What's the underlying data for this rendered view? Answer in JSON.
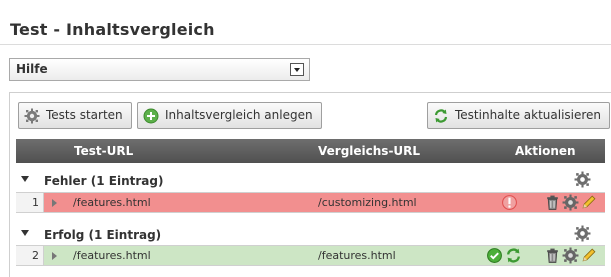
{
  "page": {
    "title": "Test - Inhaltsvergleich"
  },
  "help": {
    "selected": "Hilfe"
  },
  "toolbar": {
    "start_tests": "Tests starten",
    "create_comparison": "Inhaltsvergleich anlegen",
    "update_contents": "Testinhalte aktualisieren"
  },
  "table": {
    "headers": {
      "test_url": "Test-URL",
      "compare_url": "Vergleichs-URL",
      "actions": "Aktionen"
    },
    "groups": [
      {
        "label": "Fehler (1 Eintrag)",
        "status": "error",
        "rows": [
          {
            "index": "1",
            "test_url": "/features.html",
            "compare_url": "/customizing.html"
          }
        ]
      },
      {
        "label": "Erfolg (1 Eintrag)",
        "status": "success",
        "rows": [
          {
            "index": "2",
            "test_url": "/features.html",
            "compare_url": "/features.html"
          }
        ]
      }
    ]
  },
  "colors": {
    "error_row": "#f28f8f",
    "success_row": "#cde6c5",
    "header": "#5a5a5a"
  },
  "icons": [
    "gear-icon",
    "plus-circle-icon",
    "refresh-icon",
    "warning-icon",
    "check-icon",
    "trash-icon",
    "pencil-icon"
  ]
}
